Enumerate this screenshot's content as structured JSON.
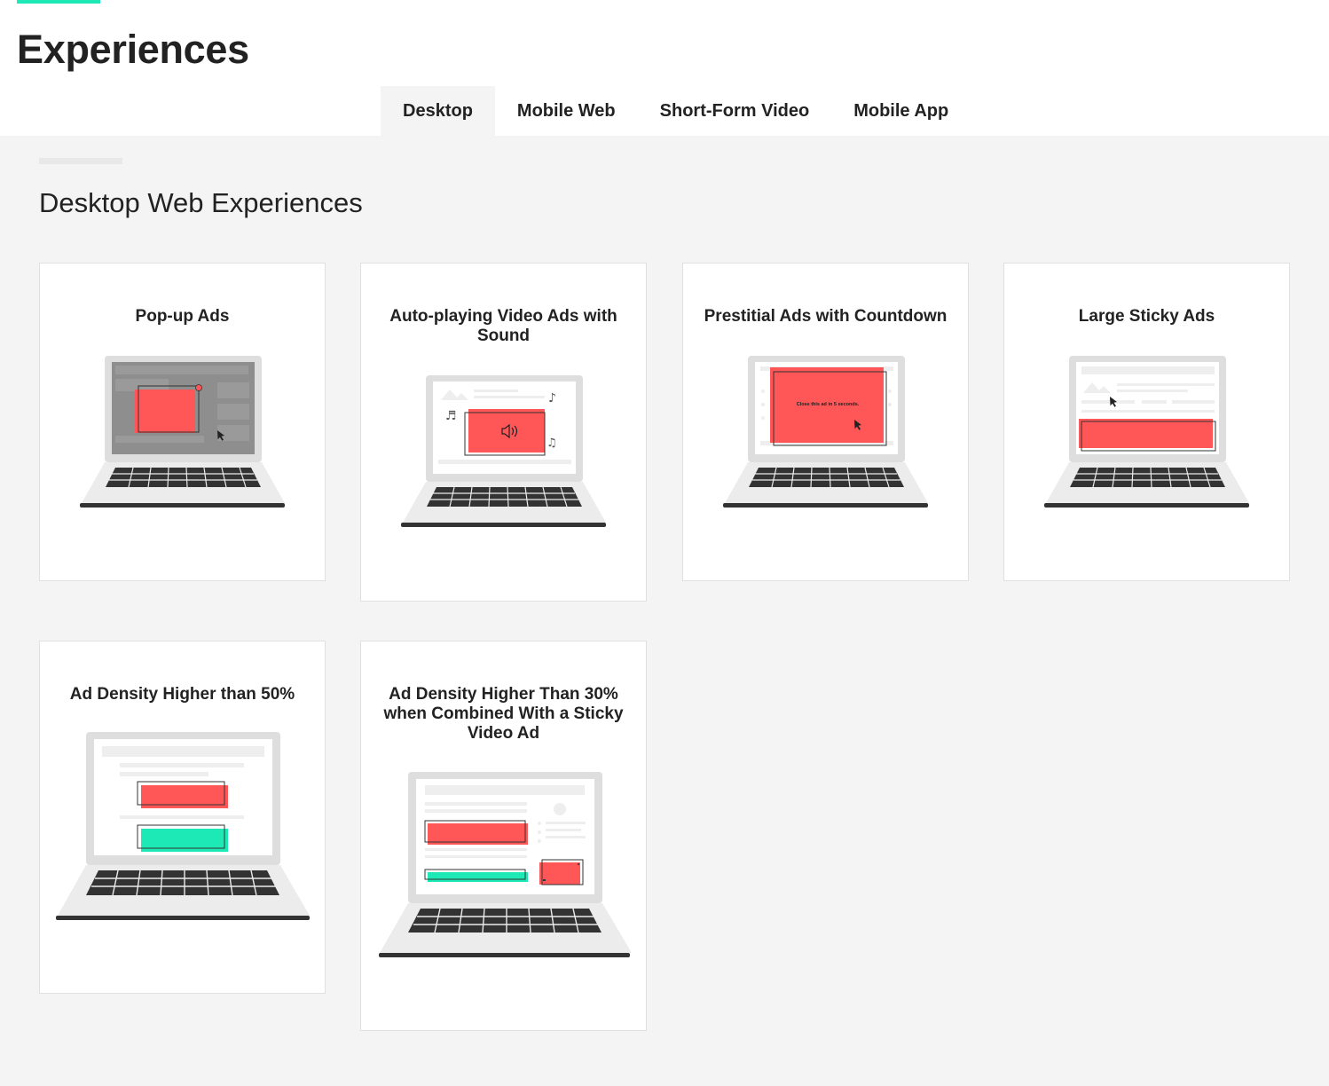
{
  "header": {
    "title": "Experiences",
    "accent_color": "#1de9b6",
    "tabs": [
      {
        "label": "Desktop",
        "active": true
      },
      {
        "label": "Mobile Web",
        "active": false
      },
      {
        "label": "Short-Form Video",
        "active": false
      },
      {
        "label": "Mobile App",
        "active": false
      }
    ]
  },
  "section": {
    "title": "Desktop Web Experiences"
  },
  "cards": [
    {
      "title": "Pop-up Ads",
      "illustration": "laptop-popup-ad-icon"
    },
    {
      "title": "Auto-playing Video Ads with Sound",
      "illustration": "laptop-video-sound-icon"
    },
    {
      "title": "Prestitial Ads with Countdown",
      "illustration": "laptop-prestitial-icon",
      "countdown_text": "Close this ad in 5 seconds."
    },
    {
      "title": "Large Sticky Ads",
      "illustration": "laptop-sticky-ad-icon"
    },
    {
      "title": "Ad Density Higher than 50%",
      "illustration": "laptop-ad-density-icon"
    },
    {
      "title": "Ad Density Higher Than 30% when Combined With a Sticky Video Ad",
      "illustration": "laptop-sticky-video-density-icon"
    }
  ],
  "colors": {
    "ad_red": "#ff5757",
    "ad_teal": "#1de9b6",
    "laptop_gray": "#dedede",
    "keyboard": "#333333"
  }
}
